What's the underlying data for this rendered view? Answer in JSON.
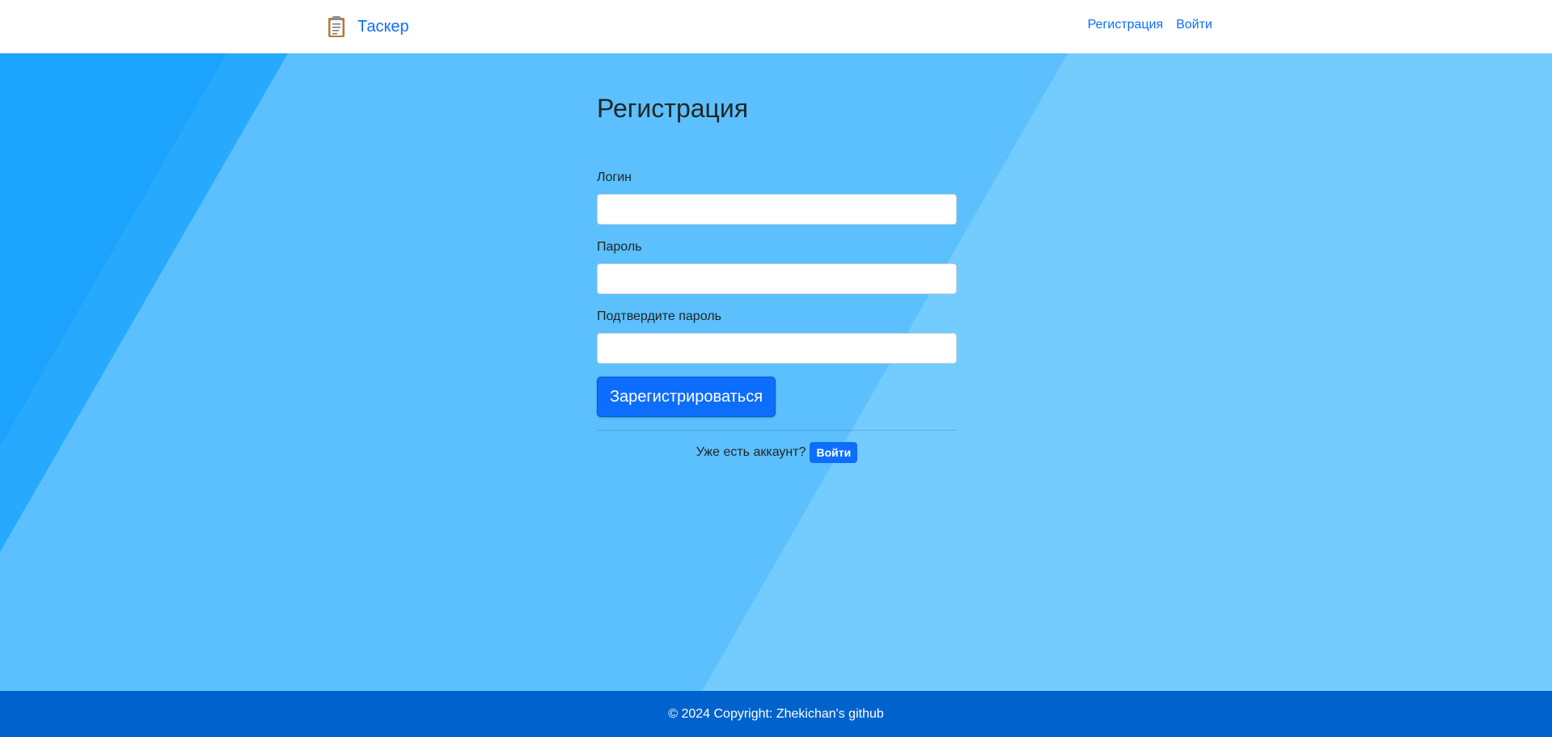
{
  "header": {
    "brand_icon": "clipboard-icon",
    "brand_name": "Таскер",
    "nav": [
      {
        "label": "Регистрация"
      },
      {
        "label": "Войти"
      }
    ]
  },
  "form": {
    "title": "Регистрация",
    "login": {
      "label": "Логин",
      "value": "",
      "placeholder": ""
    },
    "password": {
      "label": "Пароль",
      "value": "",
      "placeholder": ""
    },
    "confirm": {
      "label": "Подтвердите пароль",
      "value": "",
      "placeholder": ""
    },
    "submit_label": "Зарегистрироваться",
    "has_account_text": "Уже есть аккаунт?",
    "login_button_label": "Войти"
  },
  "footer": {
    "copyright": "© 2024 Copyright: Zhekichan's github"
  },
  "colors": {
    "primary": "#0d6efd",
    "background": "#5bc0fd",
    "footer": "#0062cc"
  }
}
